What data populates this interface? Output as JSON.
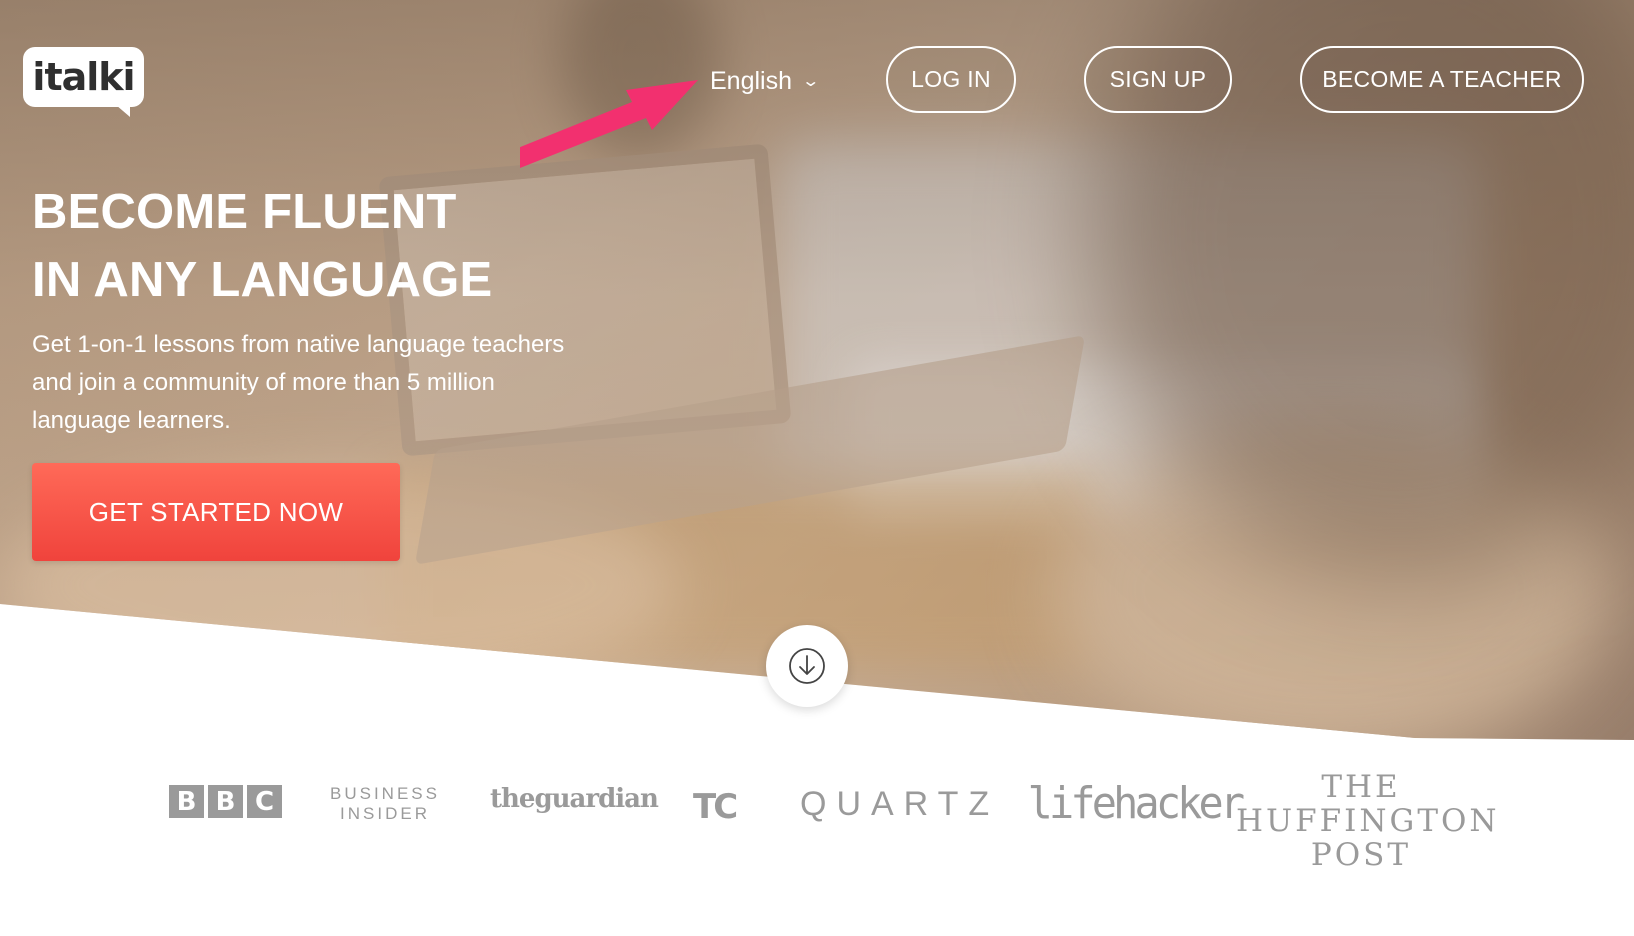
{
  "brand": {
    "logo_text": "italki"
  },
  "nav": {
    "language": "English",
    "login": "LOG IN",
    "signup": "SIGN UP",
    "become_teacher": "BECOME A TEACHER"
  },
  "hero": {
    "headline_line1": "BECOME FLUENT",
    "headline_line2": "IN ANY LANGUAGE",
    "sub_line1": "Get 1-on-1 lessons from native language teachers",
    "sub_line2": "and join a community of more than 5 million",
    "sub_line3": "language learners.",
    "cta": "GET STARTED NOW"
  },
  "press": {
    "bbc": [
      "B",
      "B",
      "C"
    ],
    "business_insider_line1": "BUSINESS",
    "business_insider_line2": "INSIDER",
    "guardian": "theguardian",
    "techcrunch": "TC",
    "quartz": "QUARTZ",
    "lifehacker": "lifehacker",
    "huffpost_line1": "THE",
    "huffpost_line2": "HUFFINGTON",
    "huffpost_line3": "POST"
  },
  "icons": {
    "language_dropdown": "chevron-down-icon",
    "scroll": "arrow-down-circle-icon",
    "annotation": "pink-arrow"
  },
  "colors": {
    "cta": "#f0433c",
    "annotation_arrow": "#f2306f",
    "press_gray": "#9a9a9a"
  }
}
